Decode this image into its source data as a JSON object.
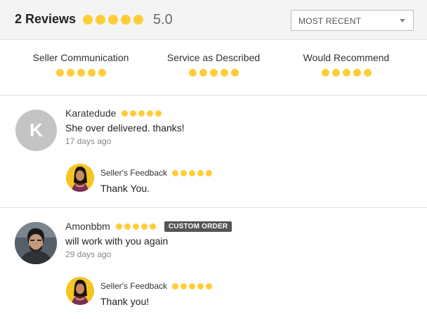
{
  "header": {
    "title": "2 Reviews",
    "rating": 5,
    "score": "5.0",
    "sort": {
      "selected": "MOST RECENT"
    }
  },
  "criteria": [
    {
      "label": "Seller Communication",
      "rating": 5
    },
    {
      "label": "Service as Described",
      "rating": 5
    },
    {
      "label": "Would Recommend",
      "rating": 5
    }
  ],
  "reviews": [
    {
      "avatar_letter": "K",
      "name": "Karatedude",
      "rating": 5,
      "text": "She over delivered. thanks!",
      "time": "17 days ago",
      "badge": "",
      "seller_feedback": {
        "label": "Seller's Feedback",
        "rating": 5,
        "text": "Thank You."
      }
    },
    {
      "avatar_letter": "",
      "name": "Amonbbm",
      "rating": 5,
      "text": "will work with you again",
      "time": "29 days ago",
      "badge": "CUSTOM ORDER",
      "seller_feedback": {
        "label": "Seller's Feedback",
        "rating": 5,
        "text": "Thank you!"
      }
    }
  ],
  "colors": {
    "star": "#ffcd39",
    "header_bg": "#f4f4f4",
    "badge_bg": "#555555"
  }
}
